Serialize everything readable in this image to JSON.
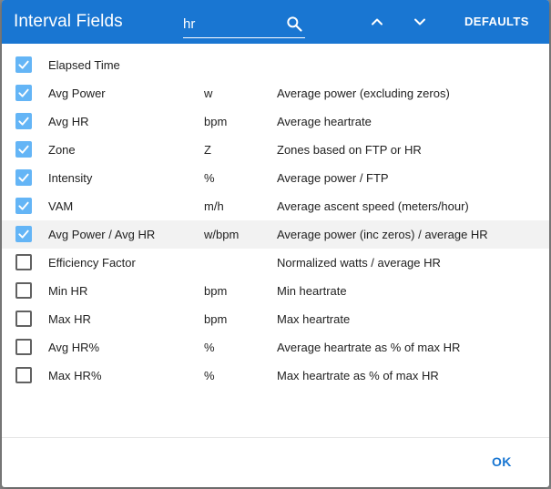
{
  "dialog": {
    "title": "Interval Fields",
    "search": {
      "value": "hr",
      "placeholder": ""
    },
    "defaults_label": "DEFAULTS",
    "ok_label": "OK"
  },
  "accent_color": "#1976d2",
  "checkbox_color": "#64b5f6",
  "fields": [
    {
      "name": "Elapsed Time",
      "unit": "",
      "description": "",
      "checked": true
    },
    {
      "name": "Avg Power",
      "unit": "w",
      "description": "Average power (excluding zeros)",
      "checked": true
    },
    {
      "name": "Avg HR",
      "unit": "bpm",
      "description": "Average heartrate",
      "checked": true
    },
    {
      "name": "Zone",
      "unit": "Z",
      "description": "Zones based on FTP or HR",
      "checked": true
    },
    {
      "name": "Intensity",
      "unit": "%",
      "description": "Average power / FTP",
      "checked": true
    },
    {
      "name": "VAM",
      "unit": "m/h",
      "description": "Average ascent speed (meters/hour)",
      "checked": true
    },
    {
      "name": "Avg Power / Avg HR",
      "unit": "w/bpm",
      "description": "Average power (inc zeros) / average HR",
      "checked": true,
      "highlighted": true
    },
    {
      "name": "Efficiency Factor",
      "unit": "",
      "description": "Normalized watts / average HR",
      "checked": false
    },
    {
      "name": "Min HR",
      "unit": "bpm",
      "description": "Min heartrate",
      "checked": false
    },
    {
      "name": "Max HR",
      "unit": "bpm",
      "description": "Max heartrate",
      "checked": false
    },
    {
      "name": "Avg HR%",
      "unit": "%",
      "description": "Average heartrate as % of max HR",
      "checked": false
    },
    {
      "name": "Max HR%",
      "unit": "%",
      "description": "Max heartrate as % of max HR",
      "checked": false
    }
  ]
}
